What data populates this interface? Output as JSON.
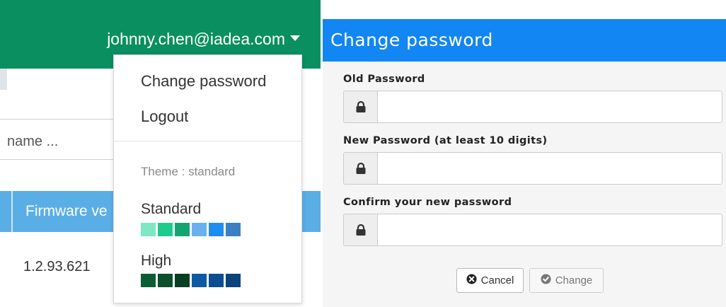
{
  "header": {
    "user_email": "johnny.chen@iadea.com"
  },
  "search": {
    "placeholder": "name ..."
  },
  "table": {
    "columns": [
      "Firmware ve"
    ],
    "rows": [
      [
        "1.2.93.621"
      ]
    ]
  },
  "user_menu": {
    "items": [
      {
        "label": "Change password"
      },
      {
        "label": "Logout"
      }
    ],
    "theme_label": "Theme : standard",
    "themes": [
      {
        "name": "Standard",
        "colors": [
          "#7de8c3",
          "#1dcb8c",
          "#13a471",
          "#6aafee",
          "#1e8df0",
          "#3b7fc4"
        ]
      },
      {
        "name": "High",
        "colors": [
          "#0b5e34",
          "#0b4f2c",
          "#083f22",
          "#0d5aa4",
          "#0c4f91",
          "#0b437c"
        ]
      }
    ]
  },
  "dialog": {
    "title": "Change password",
    "fields": [
      {
        "label": "Old Password",
        "icon": "lock-icon",
        "value": ""
      },
      {
        "label": "New Password (at least 10 digits)",
        "icon": "lock-icon",
        "value": ""
      },
      {
        "label": "Confirm your new password",
        "icon": "lock-icon",
        "value": ""
      }
    ],
    "buttons": {
      "cancel_label": "Cancel",
      "change_label": "Change"
    }
  },
  "colors": {
    "topbar": "#0a8f61",
    "table_header": "#5aaee6",
    "dialog_header": "#1286f2"
  }
}
